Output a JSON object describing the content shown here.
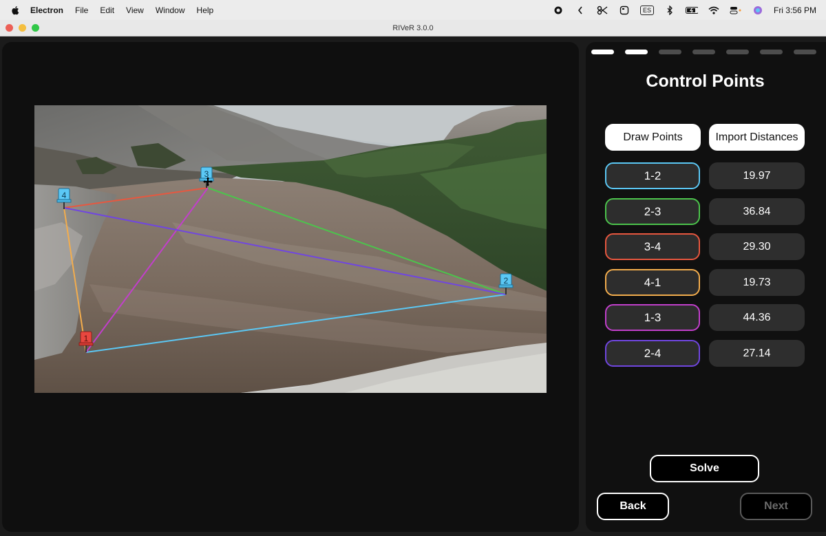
{
  "menubar": {
    "app_name": "Electron",
    "items": [
      "File",
      "Edit",
      "View",
      "Window",
      "Help"
    ],
    "input_source": "ES",
    "clock": "Fri 3:56 PM"
  },
  "window": {
    "title": "RIVeR 3.0.0"
  },
  "stepper": {
    "total_steps": 7,
    "completed_steps": 2
  },
  "panel": {
    "title": "Control Points",
    "draw_points_label": "Draw Points",
    "import_distances_label": "Import Distances",
    "pairs": [
      {
        "label": "1-2",
        "distance": "19.97",
        "color": "#5bc8f5"
      },
      {
        "label": "2-3",
        "distance": "36.84",
        "color": "#4cc44c"
      },
      {
        "label": "3-4",
        "distance": "29.30",
        "color": "#e8573f"
      },
      {
        "label": "4-1",
        "distance": "19.73",
        "color": "#f3ad4d"
      },
      {
        "label": "1-3",
        "distance": "44.36",
        "color": "#c23fcc"
      },
      {
        "label": "2-4",
        "distance": "27.14",
        "color": "#7046e0"
      }
    ],
    "solve_label": "Solve",
    "back_label": "Back",
    "next_label": "Next"
  },
  "markers": [
    {
      "label": "1",
      "color": "#e8473f"
    },
    {
      "label": "2",
      "color": "#5bc8f5"
    },
    {
      "label": "3",
      "color": "#5bc8f5"
    },
    {
      "label": "4",
      "color": "#5bc8f5"
    }
  ]
}
